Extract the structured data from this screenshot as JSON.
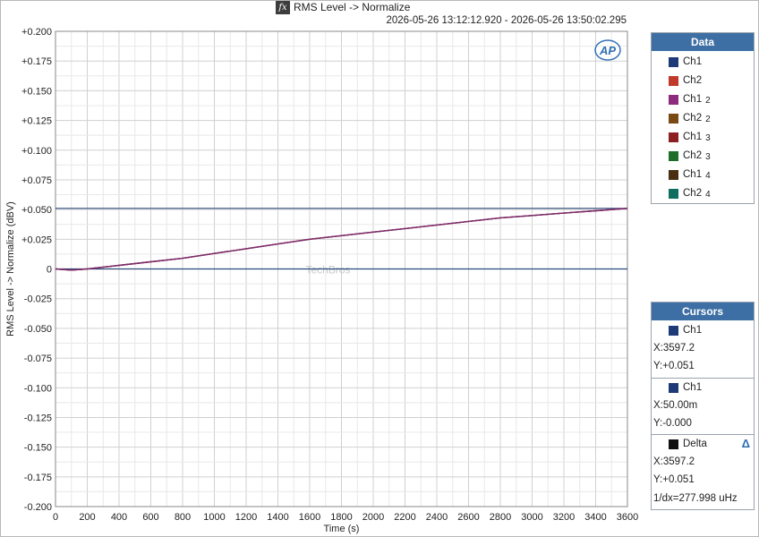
{
  "window": {
    "title": "RMS Level -> Normalize",
    "subtitle": "2026-05-26 13:12:12.920 - 2026-05-26 13:50:02.295",
    "logo_text": "AP",
    "watermark": "TechBros"
  },
  "chart_data": {
    "type": "line",
    "xlabel": "Time (s)",
    "ylabel": "RMS Level -> Normalize (dBV)",
    "xlim": [
      0,
      3600
    ],
    "ylim": [
      -0.2,
      0.2
    ],
    "x_ticks": [
      0,
      200,
      400,
      600,
      800,
      1000,
      1200,
      1400,
      1600,
      1800,
      2000,
      2200,
      2400,
      2600,
      2800,
      3000,
      3200,
      3400,
      3600
    ],
    "y_ticks": [
      0.2,
      0.175,
      0.15,
      0.125,
      0.1,
      0.075,
      0.05,
      0.025,
      0,
      -0.025,
      -0.05,
      -0.075,
      -0.1,
      -0.125,
      -0.15,
      -0.175,
      -0.2
    ],
    "y_tick_labels": [
      "+0.200",
      "+0.175",
      "+0.150",
      "+0.125",
      "+0.100",
      "+0.075",
      "+0.050",
      "+0.025",
      "0",
      "-0.025",
      "-0.050",
      "-0.075",
      "-0.100",
      "-0.125",
      "-0.150",
      "-0.175",
      "-0.200"
    ],
    "grid": true,
    "legend_placement": "right",
    "series": [
      {
        "name": "Ch1",
        "color": "#1f3a78",
        "x": [
          0,
          100,
          200,
          400,
          600,
          800,
          1000,
          1200,
          1400,
          1600,
          1800,
          2000,
          2200,
          2400,
          2600,
          2800,
          3000,
          3200,
          3400,
          3600
        ],
        "y": [
          0,
          -0.001,
          0,
          0.003,
          0.006,
          0.009,
          0.013,
          0.017,
          0.021,
          0.025,
          0.028,
          0.031,
          0.034,
          0.037,
          0.04,
          0.043,
          0.045,
          0.047,
          0.049,
          0.051
        ]
      },
      {
        "name": "Ch2",
        "color": "#c0392b",
        "x": [
          0,
          100,
          200,
          400,
          600,
          800,
          1000,
          1200,
          1400,
          1600,
          1800,
          2000,
          2200,
          2400,
          2600,
          2800,
          3000,
          3200,
          3400,
          3600
        ],
        "y": [
          0,
          -0.001,
          0,
          0.003,
          0.006,
          0.009,
          0.013,
          0.017,
          0.021,
          0.025,
          0.028,
          0.031,
          0.034,
          0.037,
          0.04,
          0.043,
          0.045,
          0.047,
          0.049,
          0.051
        ]
      },
      {
        "name": "Ch1 2",
        "color": "#7d2a6e",
        "x": [
          0,
          100,
          200,
          400,
          600,
          800,
          1000,
          1200,
          1400,
          1600,
          1800,
          2000,
          2200,
          2400,
          2600,
          2800,
          3000,
          3200,
          3400,
          3600
        ],
        "y": [
          0,
          -0.001,
          0,
          0.003,
          0.006,
          0.009,
          0.013,
          0.017,
          0.021,
          0.025,
          0.028,
          0.031,
          0.034,
          0.037,
          0.04,
          0.043,
          0.045,
          0.047,
          0.049,
          0.051
        ]
      }
    ],
    "horizontal_lines": [
      {
        "y": 0.051,
        "color": "#2a4a7a"
      },
      {
        "y": 0,
        "color": "#2a4a7a"
      }
    ]
  },
  "data_panel": {
    "header": "Data",
    "items": [
      {
        "label": "Ch1",
        "suffix": "",
        "color": "#1f3a78"
      },
      {
        "label": "Ch2",
        "suffix": "",
        "color": "#c0392b"
      },
      {
        "label": "Ch1",
        "suffix": "2",
        "color": "#8e2b7c"
      },
      {
        "label": "Ch2",
        "suffix": "2",
        "color": "#7a4a14"
      },
      {
        "label": "Ch1",
        "suffix": "3",
        "color": "#8b1f22"
      },
      {
        "label": "Ch2",
        "suffix": "3",
        "color": "#1e6e2a"
      },
      {
        "label": "Ch1",
        "suffix": "4",
        "color": "#4a2e12"
      },
      {
        "label": "Ch2",
        "suffix": "4",
        "color": "#0f6e5e"
      }
    ]
  },
  "cursors_panel": {
    "header": "Cursors",
    "cursor1": {
      "name": "Ch1",
      "color": "#1f3a78",
      "x": "X:3597.2",
      "y": "Y:+0.051"
    },
    "cursor2": {
      "name": "Ch1",
      "color": "#1f3a78",
      "x": "X:50.00m",
      "y": "Y:-0.000"
    },
    "delta": {
      "name": "Delta",
      "color": "#111111",
      "x": "X:3597.2",
      "y": "Y:+0.051",
      "dx": "1/dx=277.998 uHz",
      "icon": "delta-icon"
    }
  }
}
